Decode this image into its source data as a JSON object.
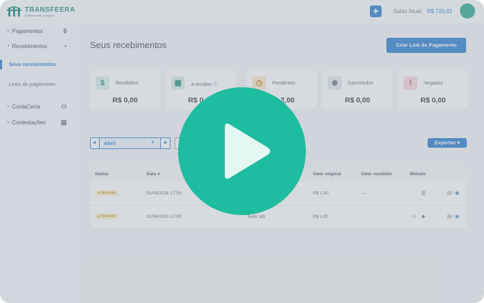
{
  "header": {
    "logo_name": "TRANSFEERA",
    "logo_tagline": "A Partnerbank company",
    "add_label": "+",
    "balance_label": "Saldo Atual:",
    "balance_value": "R$ 720,82"
  },
  "sidebar": {
    "items": [
      {
        "label": "Pagamentos",
        "icon": "$"
      },
      {
        "label": "Recebimentos",
        "icon": "▪"
      },
      {
        "label": "ContaCerta",
        "icon": "👤"
      },
      {
        "label": "Contestações",
        "icon": "▤"
      }
    ],
    "subitems": [
      {
        "label": "Seus recebimentos"
      },
      {
        "label": "Links de pagamento"
      }
    ]
  },
  "main": {
    "title": "Seus recebimentos",
    "create_label": "Criar Link de Pagamento",
    "cards": [
      {
        "label": "Recebidos",
        "value": "R$ 0,00",
        "icon": "$",
        "icon_bg": "#d9efe9",
        "icon_color": "#1f8a7a"
      },
      {
        "label": "A receber",
        "value": "R$ 0,00",
        "icon": "▦",
        "icon_bg": "#d9efe9",
        "icon_color": "#1f8a7a"
      },
      {
        "label": "Pendentes",
        "value": "R$ 2,00",
        "icon": "◷",
        "icon_bg": "#fde8cc",
        "icon_color": "#c77a12"
      },
      {
        "label": "Cancelados",
        "value": "R$ 0,00",
        "icon": "⊗",
        "icon_bg": "#e3e7eb",
        "icon_color": "#4a5661"
      },
      {
        "label": "Negados",
        "value": "R$ 0,00",
        "icon": "!",
        "icon_bg": "#f8d4da",
        "icon_color": "#c23a55"
      }
    ],
    "filter": {
      "month": "Abril",
      "prev": "◀",
      "next": "▶",
      "dropdown": "▼"
    },
    "export_label": "Exportar ▾",
    "table": {
      "headers": [
        "Status",
        "Data",
        "Valor original",
        "Valor recebido",
        "Método"
      ],
      "rows": [
        {
          "status": "Pendente",
          "date": "01/04/2026 17:00",
          "desc": "",
          "orig": "R$ 1,00",
          "recv": "---"
        },
        {
          "status": "Pendente",
          "date": "01/04/2026 17:00",
          "desc": "Teste pdi",
          "orig": "R$ 1,00",
          "recv": "---"
        }
      ]
    }
  },
  "colors": {
    "accent": "#2c7fd0",
    "brand": "#1fbd9f",
    "overlay": "rgba(150,160,170,0.38)"
  }
}
